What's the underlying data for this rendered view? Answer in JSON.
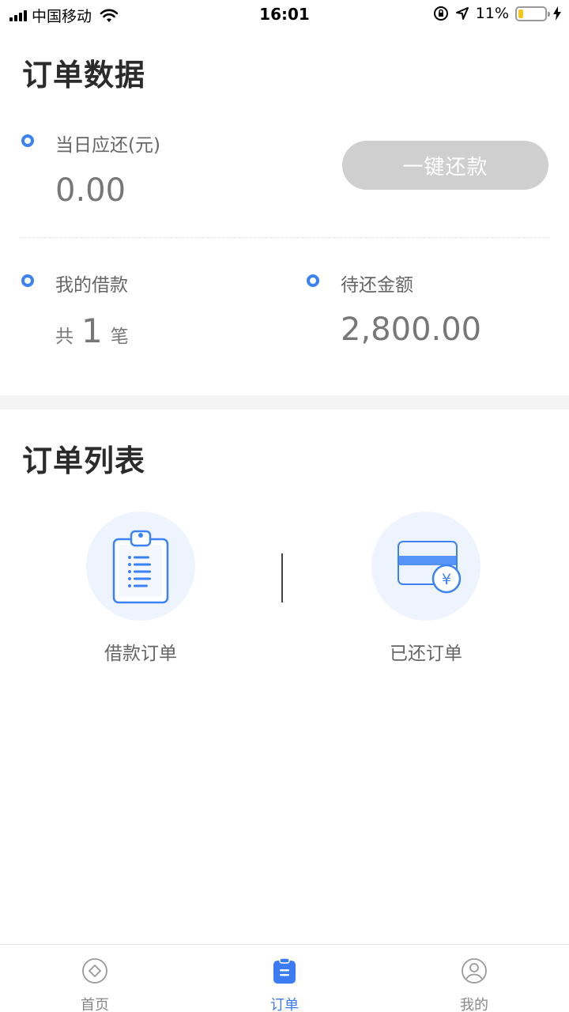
{
  "status_bar": {
    "carrier": "中国移动",
    "time": "16:01",
    "battery_percent": "11%",
    "battery_level": 0.11
  },
  "order_data": {
    "title": "订单数据",
    "due_today_label": "当日应还(元)",
    "due_today_value": "0.00",
    "repay_button": "一键还款",
    "my_loans_label": "我的借款",
    "loans_prefix": "共",
    "loans_count": "1",
    "loans_suffix": "笔",
    "pending_label": "待还金额",
    "pending_value": "2,800.00"
  },
  "order_list": {
    "title": "订单列表",
    "items": [
      {
        "label": "借款订单",
        "icon": "clipboard-list-icon"
      },
      {
        "label": "已还订单",
        "icon": "card-yuan-icon"
      }
    ]
  },
  "tab_bar": {
    "tabs": [
      {
        "label": "首页",
        "icon": "home-diamond-icon",
        "active": false
      },
      {
        "label": "订单",
        "icon": "order-clipboard-icon",
        "active": true
      },
      {
        "label": "我的",
        "icon": "user-circle-icon",
        "active": false
      }
    ]
  },
  "colors": {
    "accent": "#3b7cf5",
    "disabled_button": "#cfcfcf",
    "icon_bg": "#eef4fe",
    "battery": "#f5c518"
  }
}
